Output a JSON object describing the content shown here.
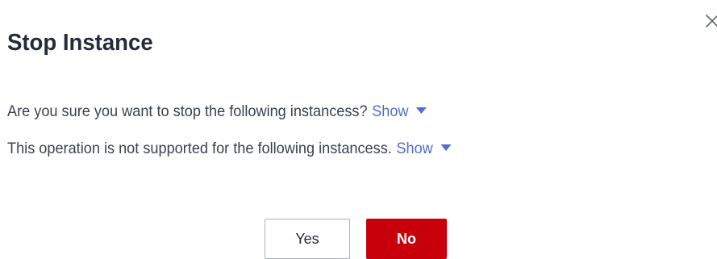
{
  "dialog": {
    "title": "Stop Instance",
    "close_icon": "close-icon",
    "messages": [
      {
        "text": "Are you sure you want to stop the following instancess?",
        "link": "Show"
      },
      {
        "text": "This operation is not supported for the following instancess.",
        "link": "Show"
      }
    ],
    "buttons": {
      "yes": "Yes",
      "no": "No"
    }
  },
  "colors": {
    "primary_button": "#c7000b",
    "link": "#526ecc",
    "title": "#252b3a",
    "text": "#3b4150",
    "secondary_border": "#adb0b8"
  }
}
